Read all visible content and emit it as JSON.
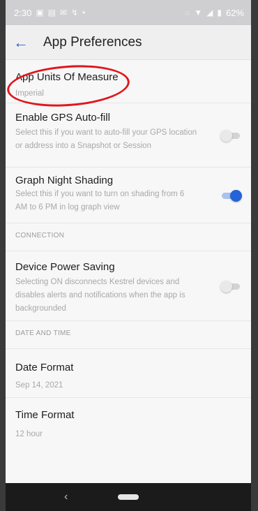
{
  "status_bar": {
    "time": "2:30",
    "left_icons": [
      "gallery-icon",
      "chat-icon",
      "mail-icon",
      "missed-call-icon",
      "dot-icon"
    ],
    "right_icons": [
      "no-sim-icon",
      "wifi-icon",
      "signal-icon",
      "battery-icon"
    ],
    "battery": "62%"
  },
  "app_bar": {
    "back_icon": "arrow-left-icon",
    "title": "App Preferences"
  },
  "preferences": {
    "units": {
      "title": "App Units Of Measure",
      "value": "Imperial"
    },
    "gps": {
      "title": "Enable GPS Auto-fill",
      "description": "Select this if you want to auto-fill your GPS location or address into a Snapshot or Session",
      "enabled": false
    },
    "night_shading": {
      "title": "Graph Night Shading",
      "description": "Select this if you want to turn on shading from 6 AM to 6 PM in log graph view",
      "enabled": true
    }
  },
  "sections": {
    "connection": "CONNECTION",
    "date_time": "DATE AND TIME"
  },
  "connection": {
    "power_saving": {
      "title": "Device Power Saving",
      "description": "Selecting ON disconnects Kestrel devices and disables alerts and notifications when the app is backgrounded",
      "enabled": false
    }
  },
  "date_time": {
    "date_format": {
      "title": "Date Format",
      "value": "Sep 14, 2021"
    },
    "time_format": {
      "title": "Time Format",
      "value": "12 hour"
    }
  },
  "nav_bar": {
    "back_icon": "nav-back-icon",
    "home_icon": "home-pill-icon"
  },
  "colors": {
    "accent": "#2563d6",
    "annotation": "#e1161c"
  }
}
